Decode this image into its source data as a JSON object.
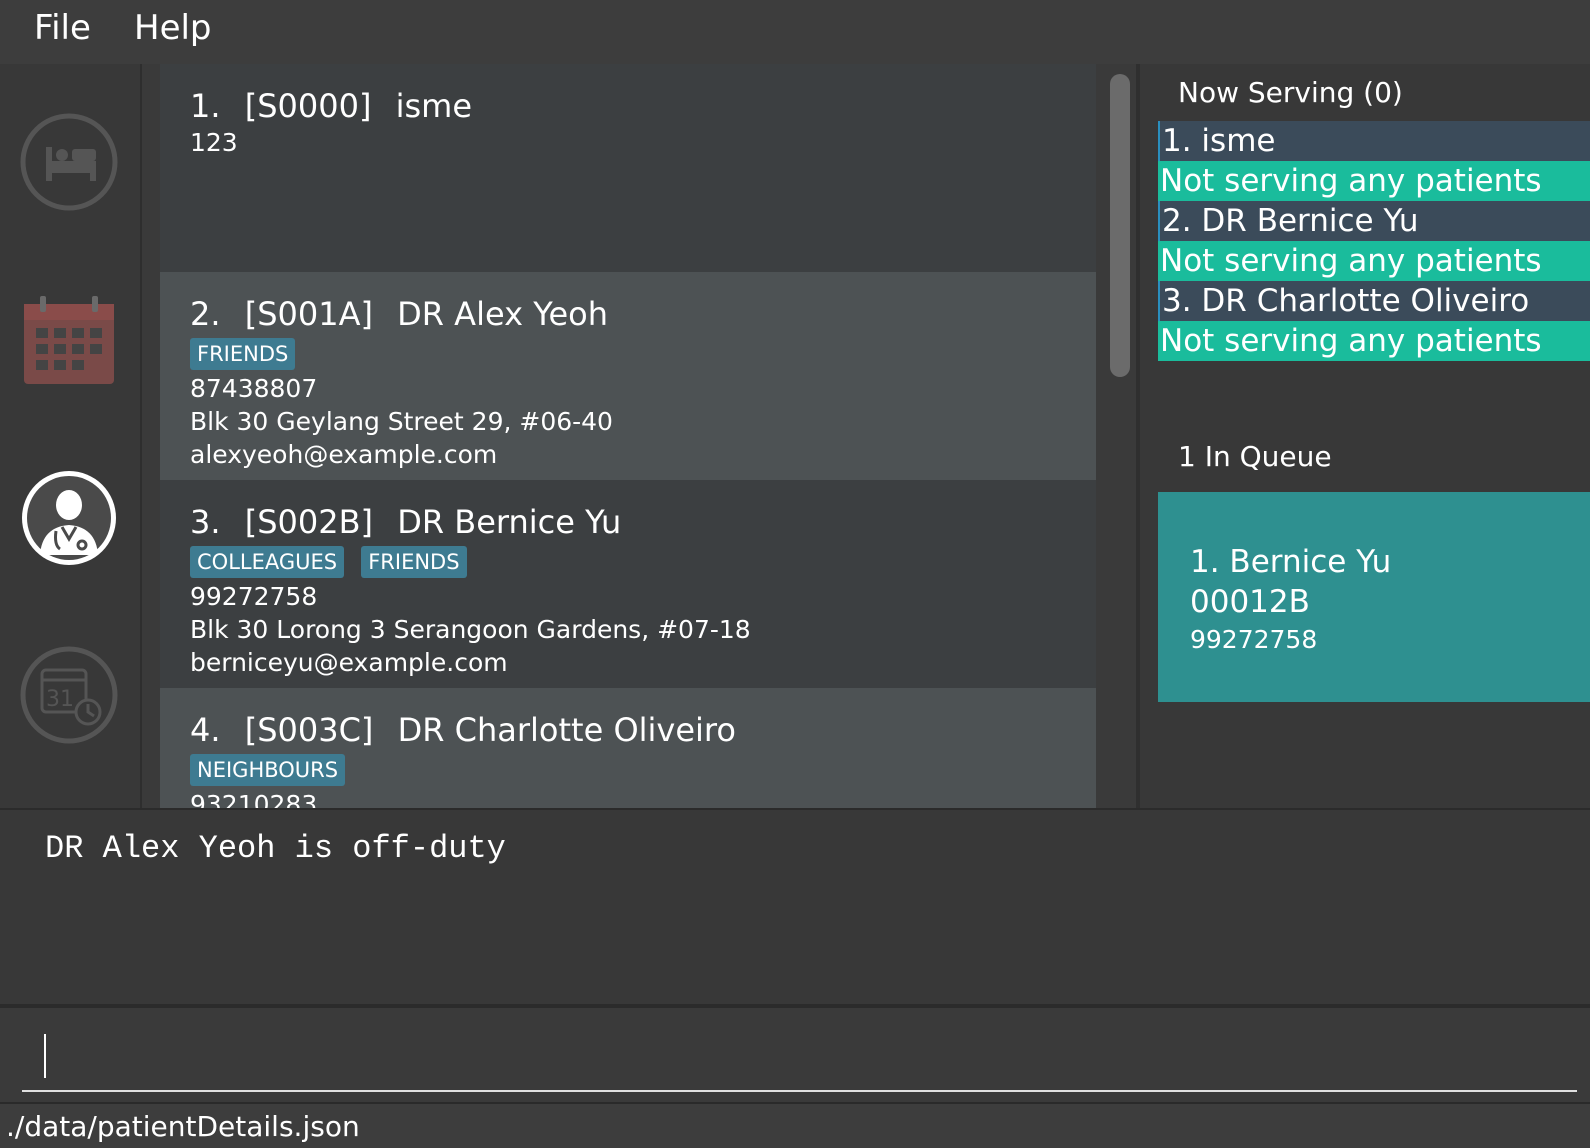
{
  "menu": {
    "file_label": "File",
    "help_label": "Help"
  },
  "sidebar": {
    "items": [
      {
        "icon": "bed-icon"
      },
      {
        "icon": "calendar-icon"
      },
      {
        "icon": "doctor-icon"
      },
      {
        "icon": "calendar-clock-icon"
      }
    ]
  },
  "persons": [
    {
      "index": "1.",
      "id": "[S0000]",
      "name": "isme",
      "tags": [],
      "lines": [
        "123"
      ]
    },
    {
      "index": "2.",
      "id": "[S001A]",
      "name": "DR Alex Yeoh",
      "tags": [
        "FRIENDS"
      ],
      "lines": [
        "87438807",
        "Blk 30 Geylang Street 29, #06-40",
        "alexyeoh@example.com"
      ]
    },
    {
      "index": "3.",
      "id": "[S002B]",
      "name": "DR Bernice Yu",
      "tags": [
        "COLLEAGUES",
        "FRIENDS"
      ],
      "lines": [
        "99272758",
        "Blk 30 Lorong 3 Serangoon Gardens, #07-18",
        "berniceyu@example.com"
      ]
    },
    {
      "index": "4.",
      "id": "[S003C]",
      "name": "DR Charlotte Oliveiro",
      "tags": [
        "NEIGHBOURS"
      ],
      "lines": [
        "93210283"
      ]
    }
  ],
  "serving": {
    "heading": "Now Serving (0)",
    "rooms": [
      {
        "name": "1. isme",
        "status": "Not serving any patients"
      },
      {
        "name": "2. DR Bernice Yu",
        "status": "Not serving any patients"
      },
      {
        "name": "3. DR Charlotte Oliveiro",
        "status": "Not serving any patients"
      }
    ]
  },
  "queue": {
    "heading": "1 In Queue",
    "items": [
      {
        "title": "1.  Bernice Yu",
        "id": "00012B",
        "phone": "99272758"
      }
    ]
  },
  "result": {
    "text": "DR Alex Yeoh is off-duty"
  },
  "command": {
    "value": "",
    "placeholder": ""
  },
  "status": {
    "path": "./data/patientDetails.json"
  },
  "colors": {
    "tag": "#3e7b91",
    "serving_status": "#1abc9c",
    "queue_card": "#2e9090"
  }
}
